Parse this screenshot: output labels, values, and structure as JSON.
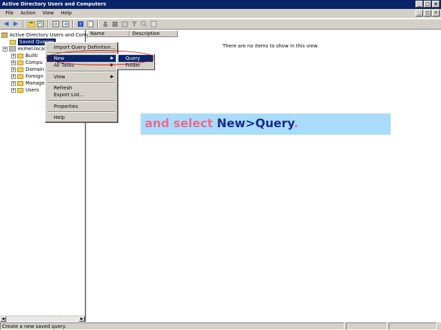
{
  "window": {
    "title": "Active Directory Users and Computers"
  },
  "titlebar_buttons": [
    "_",
    "□",
    "×"
  ],
  "menu": [
    "File",
    "Action",
    "View",
    "Help"
  ],
  "mdi_buttons": [
    "_",
    "□",
    "×"
  ],
  "toolbar_icons": [
    "back-icon",
    "forward-icon",
    "up-icon",
    "refresh-icon",
    "properties-icon",
    "export-icon",
    "help-icon"
  ],
  "tree": {
    "root": "Active Directory Users and Compu",
    "items": [
      {
        "label": "Saved Queries",
        "selected": true
      },
      {
        "label": "exmel.local",
        "expander": "+"
      },
      {
        "label": "Builti",
        "expander": "+"
      },
      {
        "label": "Compu",
        "expander": "+"
      },
      {
        "label": "Domain",
        "expander": "+"
      },
      {
        "label": "Foreign",
        "expander": "+"
      },
      {
        "label": "Manage",
        "expander": "+"
      },
      {
        "label": "Users",
        "expander": "+"
      }
    ]
  },
  "list": {
    "columns": [
      "Name",
      "Description"
    ],
    "empty_message": "There are no items to show in this view."
  },
  "context_menu": {
    "items": [
      {
        "label": "Import Query Definition..."
      },
      {
        "label": "New",
        "submenu": true,
        "highlighted": true
      },
      {
        "label": "All Tasks",
        "submenu": true
      },
      {
        "label": "View",
        "submenu": true
      },
      {
        "label": "Refresh"
      },
      {
        "label": "Export List..."
      },
      {
        "label": "Properties"
      },
      {
        "label": "Help"
      }
    ],
    "submenu": [
      "Query",
      "Folder"
    ]
  },
  "banner": {
    "part1": "and select ",
    "part2": "New>Query",
    "part3": "."
  },
  "status": {
    "text": "Create a new saved query."
  },
  "colors": {
    "highlight": "#0a246a",
    "annotation": "#d01010",
    "banner_bg": "#a9dcfb",
    "banner_pink": "#f06b8a",
    "banner_navy": "#1a2c8c"
  }
}
